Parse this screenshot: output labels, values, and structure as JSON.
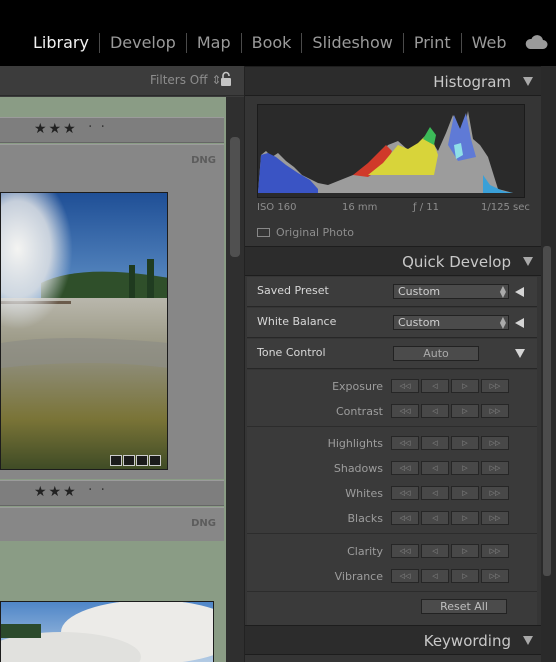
{
  "modules": [
    "Library",
    "Develop",
    "Map",
    "Book",
    "Slideshow",
    "Print",
    "Web"
  ],
  "active_module": "Library",
  "cloud_icon": "cloud-icon",
  "toolbar": {
    "filters_label": "Filters Off ⇕"
  },
  "grid": {
    "cell1": {
      "stars": "★★★",
      "dots": "··",
      "badge": "DNG"
    },
    "cell2": {
      "stars": "★★★",
      "dots": "··",
      "badge": "DNG"
    }
  },
  "histogram": {
    "title": "Histogram",
    "iso": "ISO 160",
    "focal": "16 mm",
    "aperture": "ƒ / 11",
    "shutter": "1/125 sec",
    "original_photo": "Original Photo"
  },
  "quick_develop": {
    "title": "Quick Develop",
    "saved_preset_label": "Saved Preset",
    "saved_preset_value": "Custom",
    "white_balance_label": "White Balance",
    "white_balance_value": "Custom",
    "tone_control_label": "Tone Control",
    "auto_label": "Auto",
    "controls": [
      "Exposure",
      "Contrast",
      "Highlights",
      "Shadows",
      "Whites",
      "Blacks",
      "Clarity",
      "Vibrance"
    ],
    "step_glyphs": [
      "◁◁",
      "◁",
      "▷",
      "▷▷"
    ],
    "reset_label": "Reset All"
  },
  "keywording": {
    "title": "Keywording"
  },
  "colors": {
    "accent_bg": "#353535",
    "grid_bg": "#8a9c85",
    "active_text": "#f2f2f2"
  }
}
